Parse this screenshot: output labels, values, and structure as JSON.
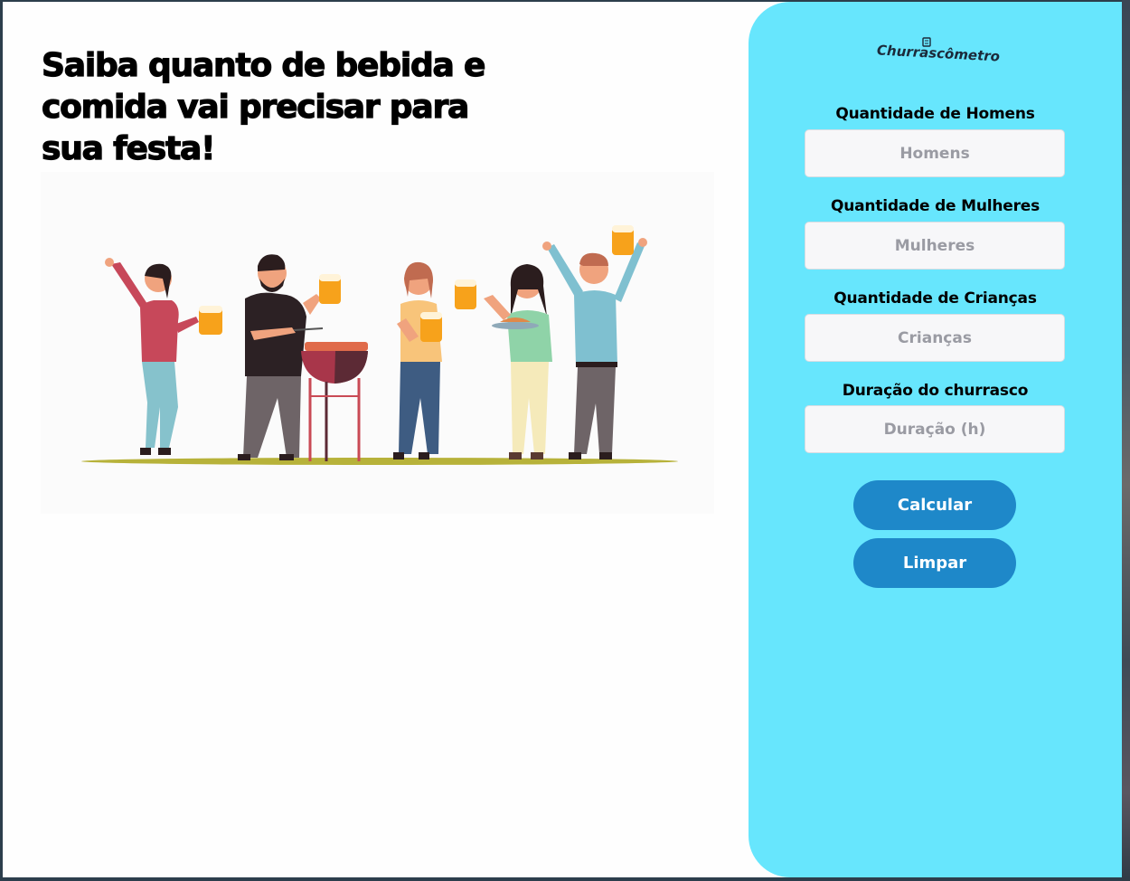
{
  "headline": "Saiba quanto de bebida e comida vai precisar para sua festa!",
  "illustration": {
    "description_icon": "barbecue-party-illustration"
  },
  "panel": {
    "logo_text": "Churrascômetro",
    "logo_icon": "cup-icon",
    "fields": [
      {
        "label": "Quantidade de Homens",
        "placeholder": "Homens",
        "value": ""
      },
      {
        "label": "Quantidade de Mulheres",
        "placeholder": "Mulheres",
        "value": ""
      },
      {
        "label": "Quantidade de Crianças",
        "placeholder": "Crianças",
        "value": ""
      },
      {
        "label": "Duração do churrasco",
        "placeholder": "Duração (h)",
        "value": ""
      }
    ],
    "buttons": {
      "calculate": "Calcular",
      "clear": "Limpar"
    }
  },
  "colors": {
    "panel_bg": "#67e6fd",
    "button_bg": "#1e88c9",
    "button_text": "#ffffff",
    "page_bg": "#fefefe"
  }
}
